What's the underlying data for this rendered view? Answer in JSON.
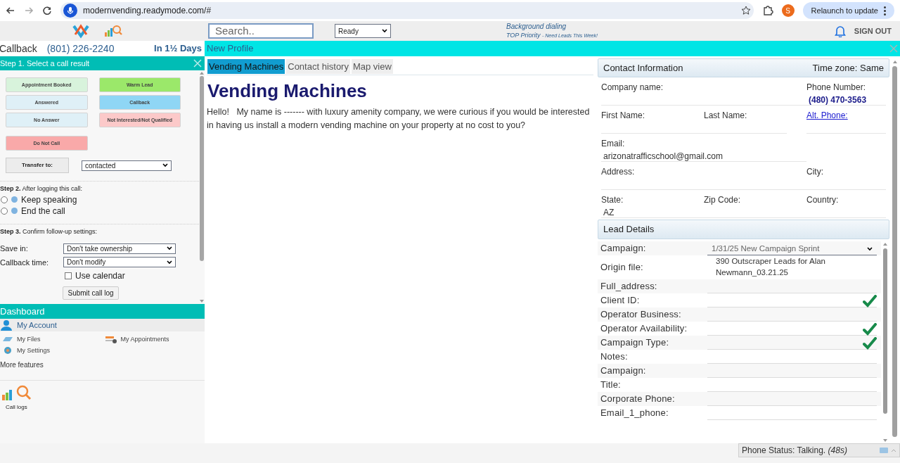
{
  "browser": {
    "url": "modernvending.readymode.com/#",
    "profile_initial": "S",
    "relaunch": "Relaunch to update"
  },
  "header": {
    "search": {
      "placeholder": "Search.."
    },
    "status_select": "Ready",
    "notice_line_1": "Background dialing",
    "notice_line_2": "TOP Priority",
    "notice_note": "- Need Leads This Week!",
    "sign_out": "SIGN OUT"
  },
  "callback_bar": {
    "label": "Callback",
    "phone": "(801) 226-2240",
    "when": "In 1½ Days"
  },
  "profile_bar": {
    "title": "New Profile"
  },
  "step1": {
    "title": "Step 1. Select a call result",
    "results": [
      {
        "label": "Appointment Booked",
        "color": "#d8f3dc"
      },
      {
        "label": "Warm Lead",
        "color": "#9be86a"
      },
      {
        "label": "Answered",
        "color": "#dff0f7"
      },
      {
        "label": "Callback",
        "color": "#8fd6f5"
      },
      {
        "label": "No Answer",
        "color": "#dff0f7"
      },
      {
        "label": "Not Interested/Not Qualified",
        "color": "#fcc9c9"
      },
      {
        "label": "Do Not Call",
        "color": "#f9a9a9"
      }
    ],
    "transfer_button": "Transfer to:",
    "transfer_select": "contacted"
  },
  "step2": {
    "heading": "Step 2.",
    "text": "After logging this call:",
    "options": [
      {
        "label": "Keep speaking",
        "selected": false
      },
      {
        "label": "End the call",
        "selected": false
      }
    ]
  },
  "step3": {
    "heading": "Step 3.",
    "text": "Confirm follow-up settings:",
    "save_in_label": "Save in:",
    "save_in_value": "Don't take ownership",
    "callback_time_label": "Callback time:",
    "callback_time_value": "Don't modify",
    "use_calendar": {
      "label": "Use calendar",
      "checked": false
    },
    "submit": "Submit call log"
  },
  "dashboard": {
    "title": "Dashboard",
    "account": "My Account",
    "links": [
      "My Files",
      "My Appointments",
      "My Settings"
    ],
    "more": "More features",
    "call_logs": "Call logs"
  },
  "tabs": [
    {
      "label": "Vending Machines",
      "selected": true
    },
    {
      "label": "Contact history",
      "selected": false
    },
    {
      "label": "Map view",
      "selected": false
    }
  ],
  "script": {
    "title": "Vending Machines",
    "body": "Hello!   My name is ------- with luxury amenity company, we were curious if you would be interested in having us install a modern vending machine on your property at no cost to you?"
  },
  "contact": {
    "title": "Contact Information",
    "time_zone": "Time zone: Same",
    "company_label": "Company name:",
    "phone_label": "Phone Number:",
    "phone": "(480) 470-3563",
    "first_label": "First Name:",
    "last_label": "Last Name:",
    "alt_phone": "Alt. Phone:",
    "email_label": "Email:",
    "email": "arizonatrafficschool@gmail.com",
    "address_label": "Address:",
    "city_label": "City:",
    "state_label": "State:",
    "state": "AZ",
    "zip_label": "Zip Code:",
    "country_label": "Country:"
  },
  "lead": {
    "title": "Lead Details",
    "rows": [
      {
        "label": "Campaign:",
        "kind": "select",
        "value": "1/31/25 New Campaign Sprint"
      },
      {
        "label": "Origin file:",
        "kind": "text",
        "value": "390 Outscraper Leads for Alan Newmann_03.21.25"
      },
      {
        "label": "Full_address:",
        "kind": "field",
        "checked": false
      },
      {
        "label": "Client ID:",
        "kind": "field",
        "checked": true
      },
      {
        "label": "Operator Business:",
        "kind": "field",
        "checked": false
      },
      {
        "label": "Operator Availability:",
        "kind": "field",
        "checked": true
      },
      {
        "label": "Campaign Type:",
        "kind": "field",
        "checked": true
      },
      {
        "label": "Notes:",
        "kind": "field",
        "checked": false
      },
      {
        "label": "Campaign:",
        "kind": "field",
        "checked": false
      },
      {
        "label": "Title:",
        "kind": "field",
        "checked": false
      },
      {
        "label": "Corporate Phone:",
        "kind": "field",
        "checked": false
      },
      {
        "label": "Email_1_phone:",
        "kind": "field",
        "checked": false
      }
    ]
  },
  "phone_status": {
    "text": "Phone Status: Talking.",
    "time": "(48s)"
  }
}
